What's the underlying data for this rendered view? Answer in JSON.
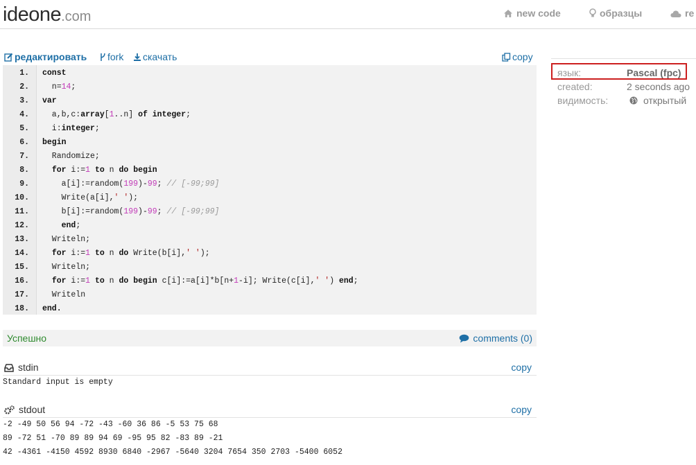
{
  "header": {
    "logo_main": "ideone",
    "logo_tld": ".com",
    "nav": [
      {
        "label": "new code",
        "icon": "home-icon"
      },
      {
        "label": "образцы",
        "icon": "lightbulb-icon"
      },
      {
        "label": "re",
        "icon": "cloud-icon"
      }
    ]
  },
  "toolbar": {
    "edit_label": "редактировать",
    "fork_label": "fork",
    "download_label": "скачать",
    "copy_label": "copy"
  },
  "code": {
    "line_numbers": [
      "1.",
      "2.",
      "3.",
      "4.",
      "5.",
      "6.",
      "7.",
      "8.",
      "9.",
      "10.",
      "11.",
      "12.",
      "13.",
      "14.",
      "15.",
      "16.",
      "17.",
      "18."
    ],
    "lines": [
      [
        {
          "t": "const",
          "c": "kw"
        }
      ],
      [
        {
          "t": "  n=",
          "c": ""
        },
        {
          "t": "14",
          "c": "num"
        },
        {
          "t": ";",
          "c": ""
        }
      ],
      [
        {
          "t": "var",
          "c": "kw"
        }
      ],
      [
        {
          "t": "  a,b,c:",
          "c": ""
        },
        {
          "t": "array",
          "c": "kw"
        },
        {
          "t": "[",
          "c": ""
        },
        {
          "t": "1",
          "c": "num"
        },
        {
          "t": "..n] ",
          "c": ""
        },
        {
          "t": "of",
          "c": "kw"
        },
        {
          "t": " ",
          "c": ""
        },
        {
          "t": "integer",
          "c": "kw"
        },
        {
          "t": ";",
          "c": ""
        }
      ],
      [
        {
          "t": "  i:",
          "c": ""
        },
        {
          "t": "integer",
          "c": "kw"
        },
        {
          "t": ";",
          "c": ""
        }
      ],
      [
        {
          "t": "begin",
          "c": "kw"
        }
      ],
      [
        {
          "t": "  Randomize;",
          "c": ""
        }
      ],
      [
        {
          "t": "  ",
          "c": ""
        },
        {
          "t": "for",
          "c": "kw"
        },
        {
          "t": " i:=",
          "c": ""
        },
        {
          "t": "1",
          "c": "num"
        },
        {
          "t": " ",
          "c": ""
        },
        {
          "t": "to",
          "c": "kw"
        },
        {
          "t": " n ",
          "c": ""
        },
        {
          "t": "do",
          "c": "kw"
        },
        {
          "t": " ",
          "c": ""
        },
        {
          "t": "begin",
          "c": "kw"
        }
      ],
      [
        {
          "t": "    a[i]:=random(",
          "c": ""
        },
        {
          "t": "199",
          "c": "num"
        },
        {
          "t": ")-",
          "c": ""
        },
        {
          "t": "99",
          "c": "num"
        },
        {
          "t": "; ",
          "c": ""
        },
        {
          "t": "// [-99;99]",
          "c": "cm"
        }
      ],
      [
        {
          "t": "    Write(a[i],",
          "c": ""
        },
        {
          "t": "' '",
          "c": "str"
        },
        {
          "t": ");",
          "c": ""
        }
      ],
      [
        {
          "t": "    b[i]:=random(",
          "c": ""
        },
        {
          "t": "199",
          "c": "num"
        },
        {
          "t": ")-",
          "c": ""
        },
        {
          "t": "99",
          "c": "num"
        },
        {
          "t": "; ",
          "c": ""
        },
        {
          "t": "// [-99;99]",
          "c": "cm"
        }
      ],
      [
        {
          "t": "    ",
          "c": ""
        },
        {
          "t": "end",
          "c": "kw"
        },
        {
          "t": ";",
          "c": ""
        }
      ],
      [
        {
          "t": "  Writeln;",
          "c": ""
        }
      ],
      [
        {
          "t": "  ",
          "c": ""
        },
        {
          "t": "for",
          "c": "kw"
        },
        {
          "t": " i:=",
          "c": ""
        },
        {
          "t": "1",
          "c": "num"
        },
        {
          "t": " ",
          "c": ""
        },
        {
          "t": "to",
          "c": "kw"
        },
        {
          "t": " n ",
          "c": ""
        },
        {
          "t": "do",
          "c": "kw"
        },
        {
          "t": " Write(b[i],",
          "c": ""
        },
        {
          "t": "' '",
          "c": "str"
        },
        {
          "t": ");",
          "c": ""
        }
      ],
      [
        {
          "t": "  Writeln;",
          "c": ""
        }
      ],
      [
        {
          "t": "  ",
          "c": ""
        },
        {
          "t": "for",
          "c": "kw"
        },
        {
          "t": " i:=",
          "c": ""
        },
        {
          "t": "1",
          "c": "num"
        },
        {
          "t": " ",
          "c": ""
        },
        {
          "t": "to",
          "c": "kw"
        },
        {
          "t": " n ",
          "c": ""
        },
        {
          "t": "do",
          "c": "kw"
        },
        {
          "t": " ",
          "c": ""
        },
        {
          "t": "begin",
          "c": "kw"
        },
        {
          "t": " c[i]:=a[i]*b[n+",
          "c": ""
        },
        {
          "t": "1",
          "c": "num"
        },
        {
          "t": "-i]; Write(c[i],",
          "c": ""
        },
        {
          "t": "' '",
          "c": "str"
        },
        {
          "t": ") ",
          "c": ""
        },
        {
          "t": "end",
          "c": "kw"
        },
        {
          "t": ";",
          "c": ""
        }
      ],
      [
        {
          "t": "  Writeln",
          "c": ""
        }
      ],
      [
        {
          "t": "end.",
          "c": "kw"
        }
      ]
    ]
  },
  "status": {
    "result": "Успешно",
    "comments_label": "comments (0)"
  },
  "stdin": {
    "title": "stdin",
    "copy_label": "copy",
    "content": "Standard input is empty"
  },
  "stdout": {
    "title": "stdout",
    "copy_label": "copy",
    "lines": [
      "-2 -49 50 56 94 -72 -43 -60 36 86 -5 53 75 68",
      "89 -72 51 -70 89 89 94 69 -95 95 82 -83 89 -21",
      "42 -4361 -4150 4592 8930 6840 -2967 -5640 3204 7654 350 2703 -5400 6052"
    ]
  },
  "sidebar": {
    "language_key": "язык:",
    "language_value": "Pascal (fpc)",
    "created_key": "created:",
    "created_value": "2 seconds ago",
    "visibility_key": "видимость:",
    "visibility_value": "открытый"
  },
  "colors": {
    "link": "#1e6fa6",
    "success": "#2e8a2e",
    "highlight_box": "#cc1f1f"
  }
}
